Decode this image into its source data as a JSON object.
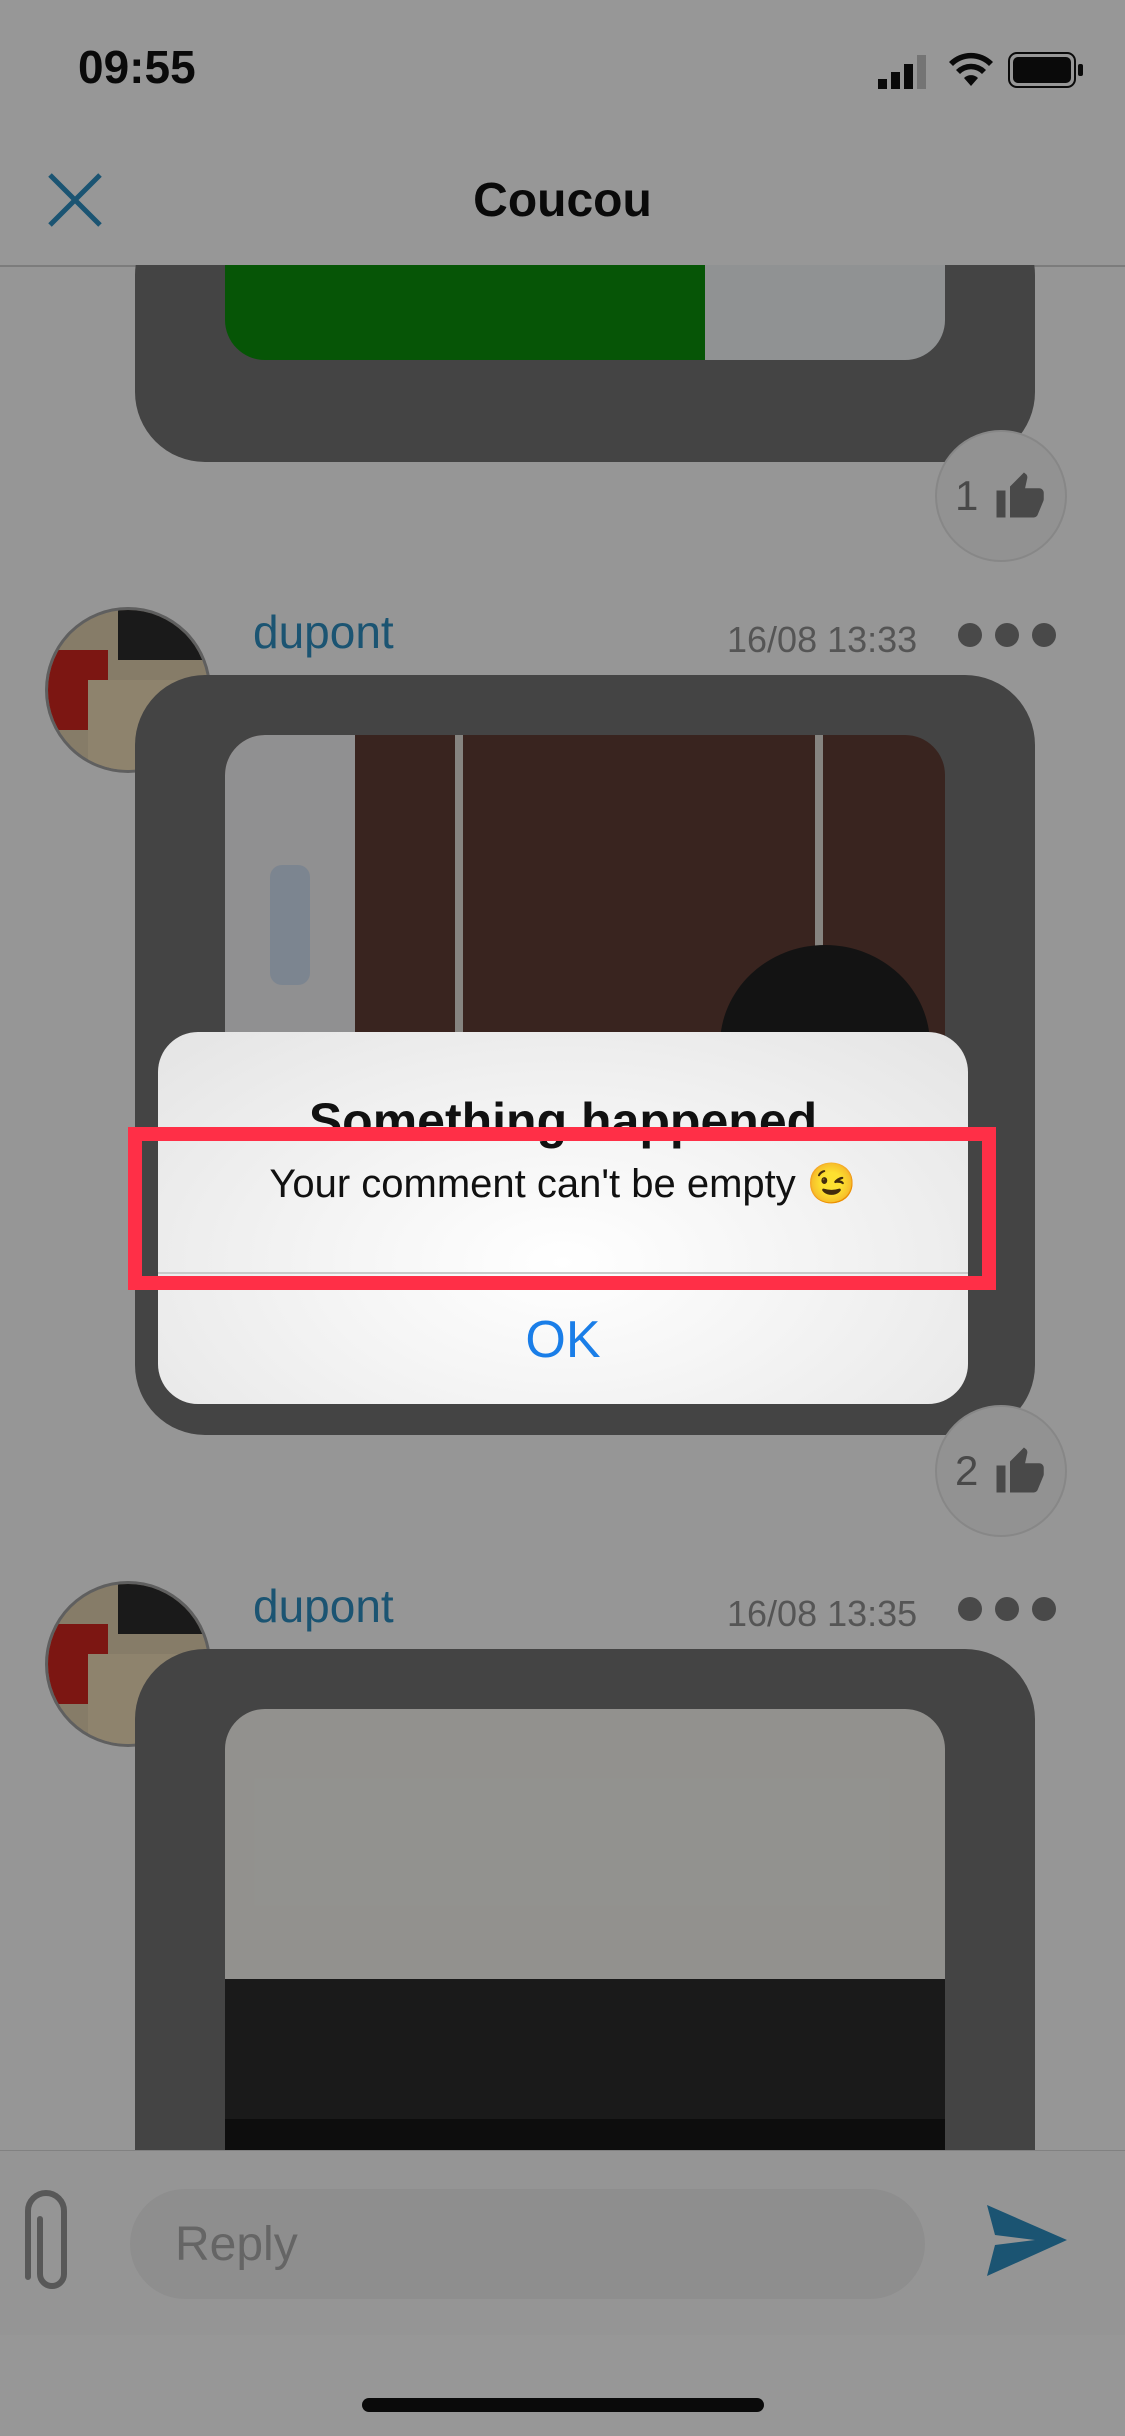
{
  "status_bar": {
    "time": "09:55"
  },
  "header": {
    "title": "Coucou"
  },
  "posts": [
    {
      "likes": "1"
    },
    {
      "user": "dupont",
      "timestamp": "16/08 13:33",
      "likes": "2"
    },
    {
      "user": "dupont",
      "timestamp": "16/08 13:35"
    }
  ],
  "reply": {
    "placeholder": "Reply"
  },
  "alert": {
    "title": "Something happened",
    "message": "Your comment can't be empty 😉",
    "ok_label": "OK"
  },
  "colors": {
    "accent": "#2d88b8",
    "alert_button": "#1a7ee8",
    "highlight": "#ff2f47"
  }
}
